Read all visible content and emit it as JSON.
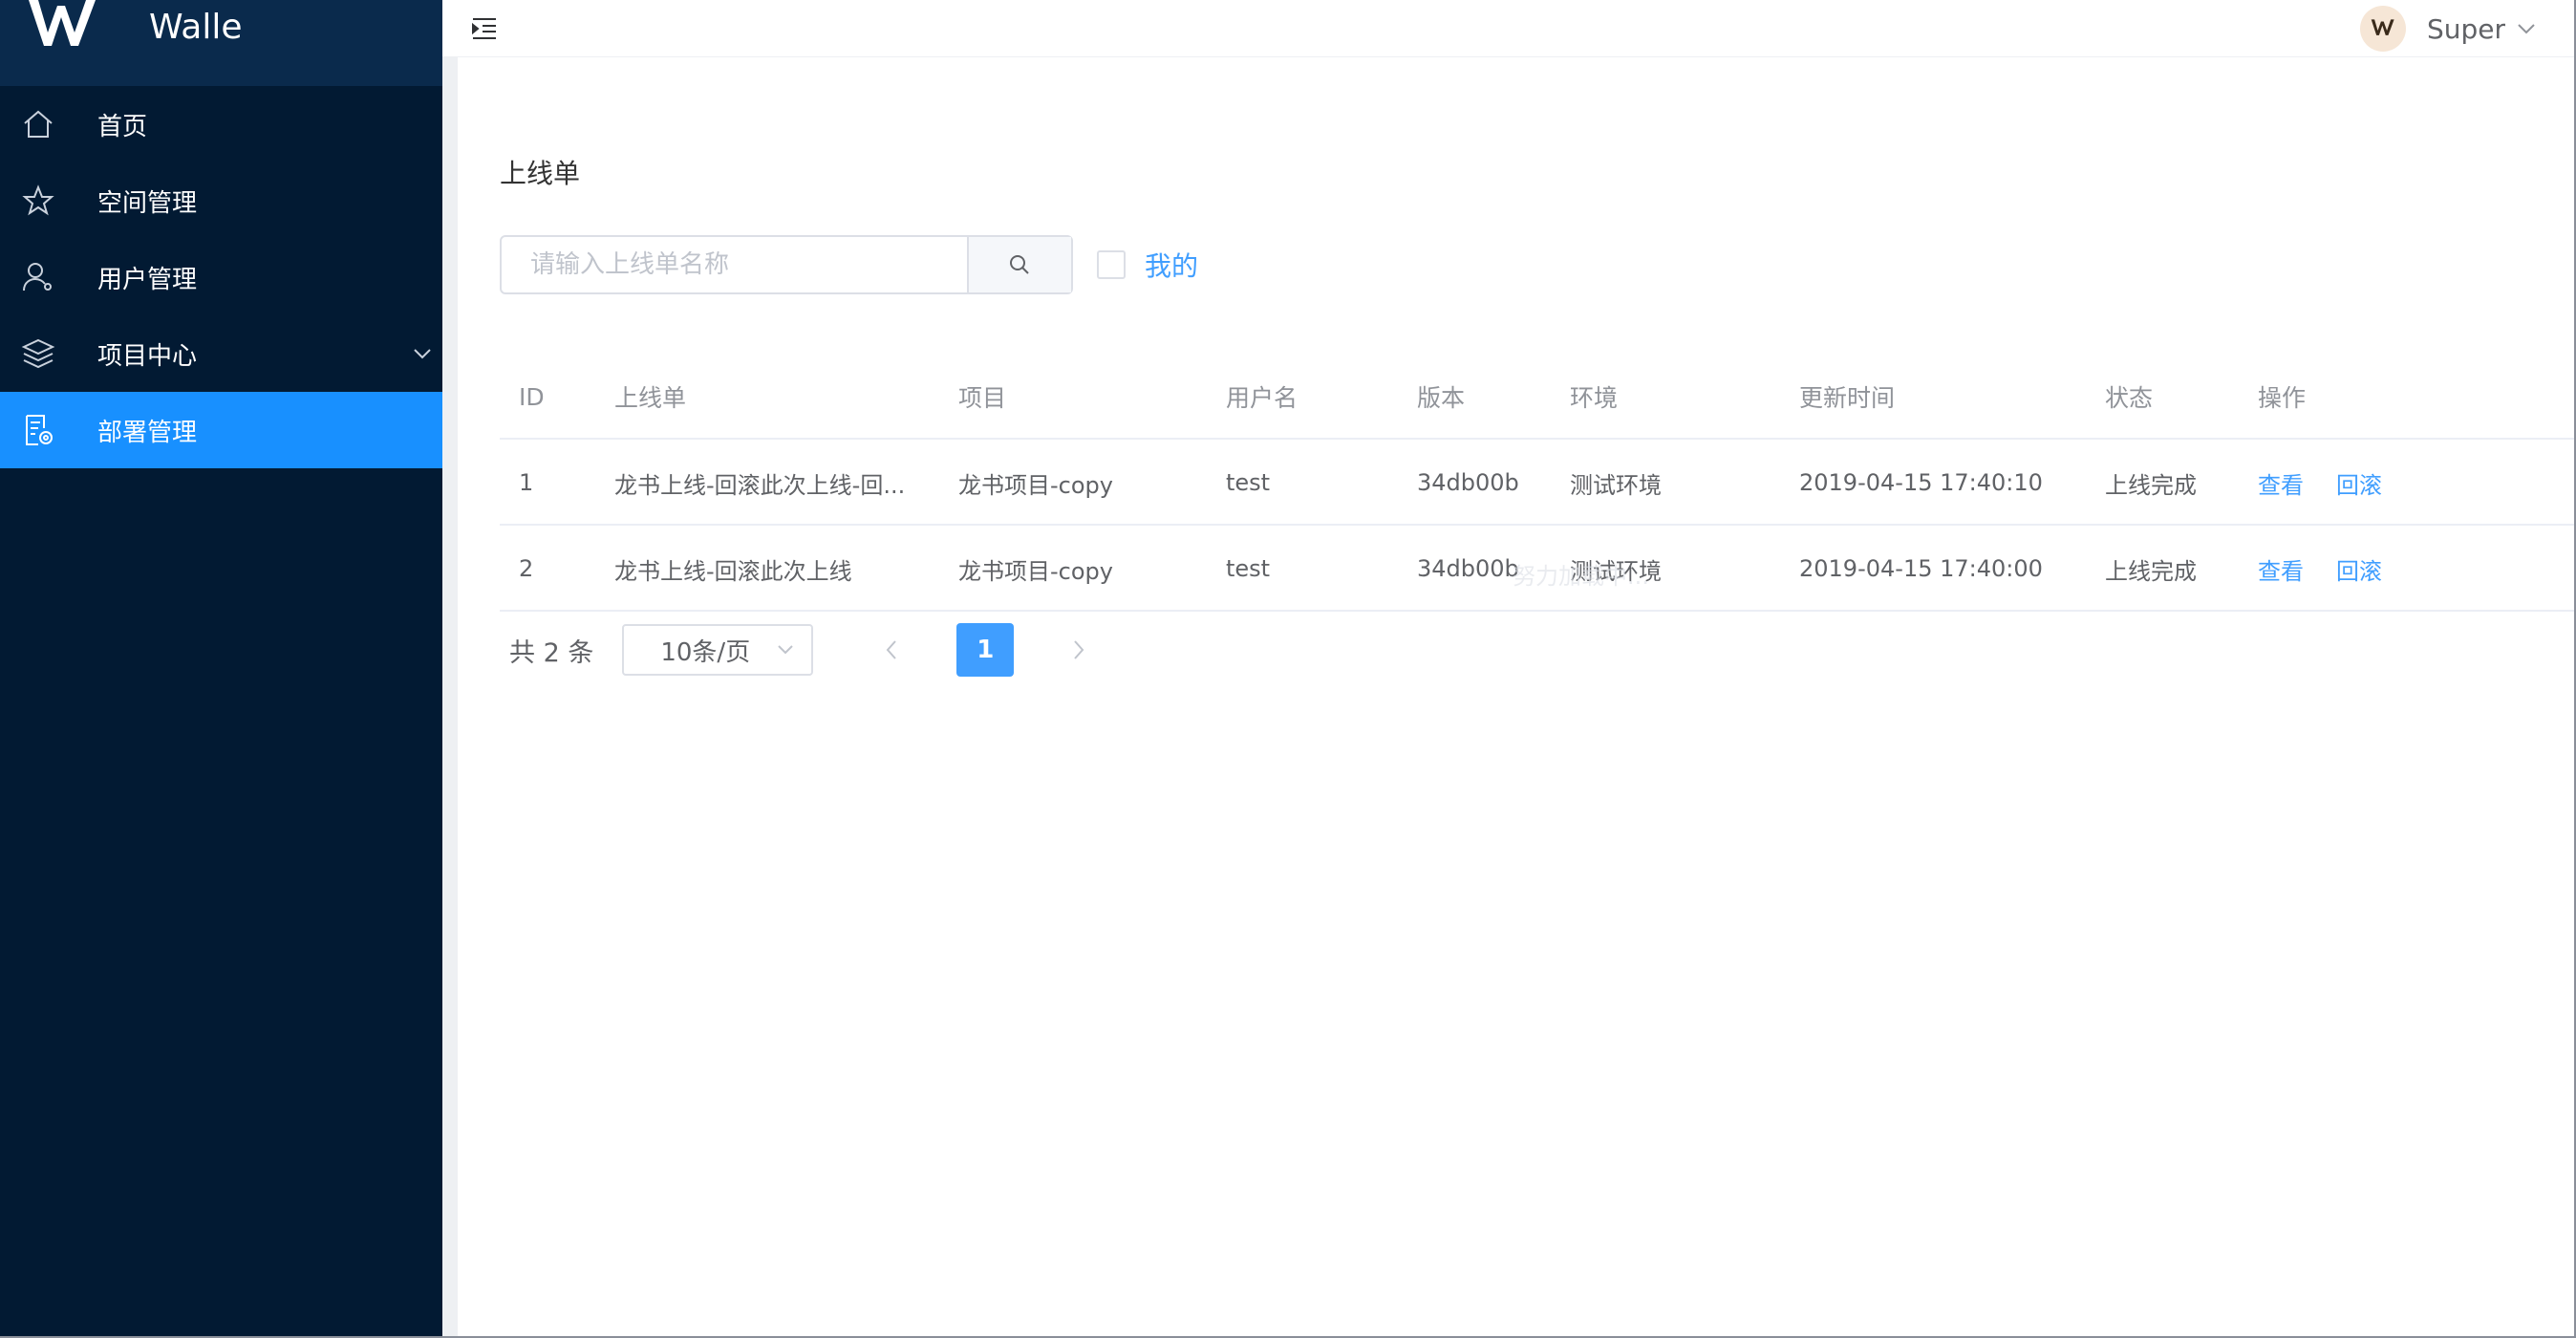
{
  "app": {
    "title": "Walle",
    "accent": "#1890ff",
    "sidebar_bg": "#021a33"
  },
  "sidebar": {
    "items": [
      {
        "label": "首页",
        "icon": "home-icon",
        "active": false
      },
      {
        "label": "空间管理",
        "icon": "star-icon",
        "active": false
      },
      {
        "label": "用户管理",
        "icon": "user-icon",
        "active": false
      },
      {
        "label": "项目中心",
        "icon": "layers-icon",
        "active": false,
        "has_submenu": true
      },
      {
        "label": "部署管理",
        "icon": "deploy-doc-icon",
        "active": true
      }
    ]
  },
  "header": {
    "user_name": "Super"
  },
  "page": {
    "title": "上线单"
  },
  "search": {
    "placeholder": "请输入上线单名称",
    "value": ""
  },
  "filter": {
    "mine_label": "我的",
    "mine_checked": false
  },
  "table": {
    "columns": [
      "ID",
      "上线单",
      "项目",
      "用户名",
      "版本",
      "环境",
      "更新时间",
      "状态",
      "操作"
    ],
    "rows": [
      {
        "id": "1",
        "name": "龙书上线-回滚此次上线-回...",
        "project": "龙书项目-copy",
        "user": "test",
        "version": "34db00b",
        "env": "测试环境",
        "updated": "2019-04-15 17:40:10",
        "status": "上线完成",
        "actions": [
          "查看",
          "回滚"
        ]
      },
      {
        "id": "2",
        "name": "龙书上线-回滚此次上线",
        "project": "龙书项目-copy",
        "user": "test",
        "version": "34db00b",
        "env": "测试环境",
        "updated": "2019-04-15 17:40:00",
        "status": "上线完成",
        "actions": [
          "查看",
          "回滚"
        ]
      }
    ],
    "ghost_text": "努力加载中..."
  },
  "pagination": {
    "total_text": "共 2 条",
    "page_size": "10条/页",
    "current_page": "1"
  }
}
